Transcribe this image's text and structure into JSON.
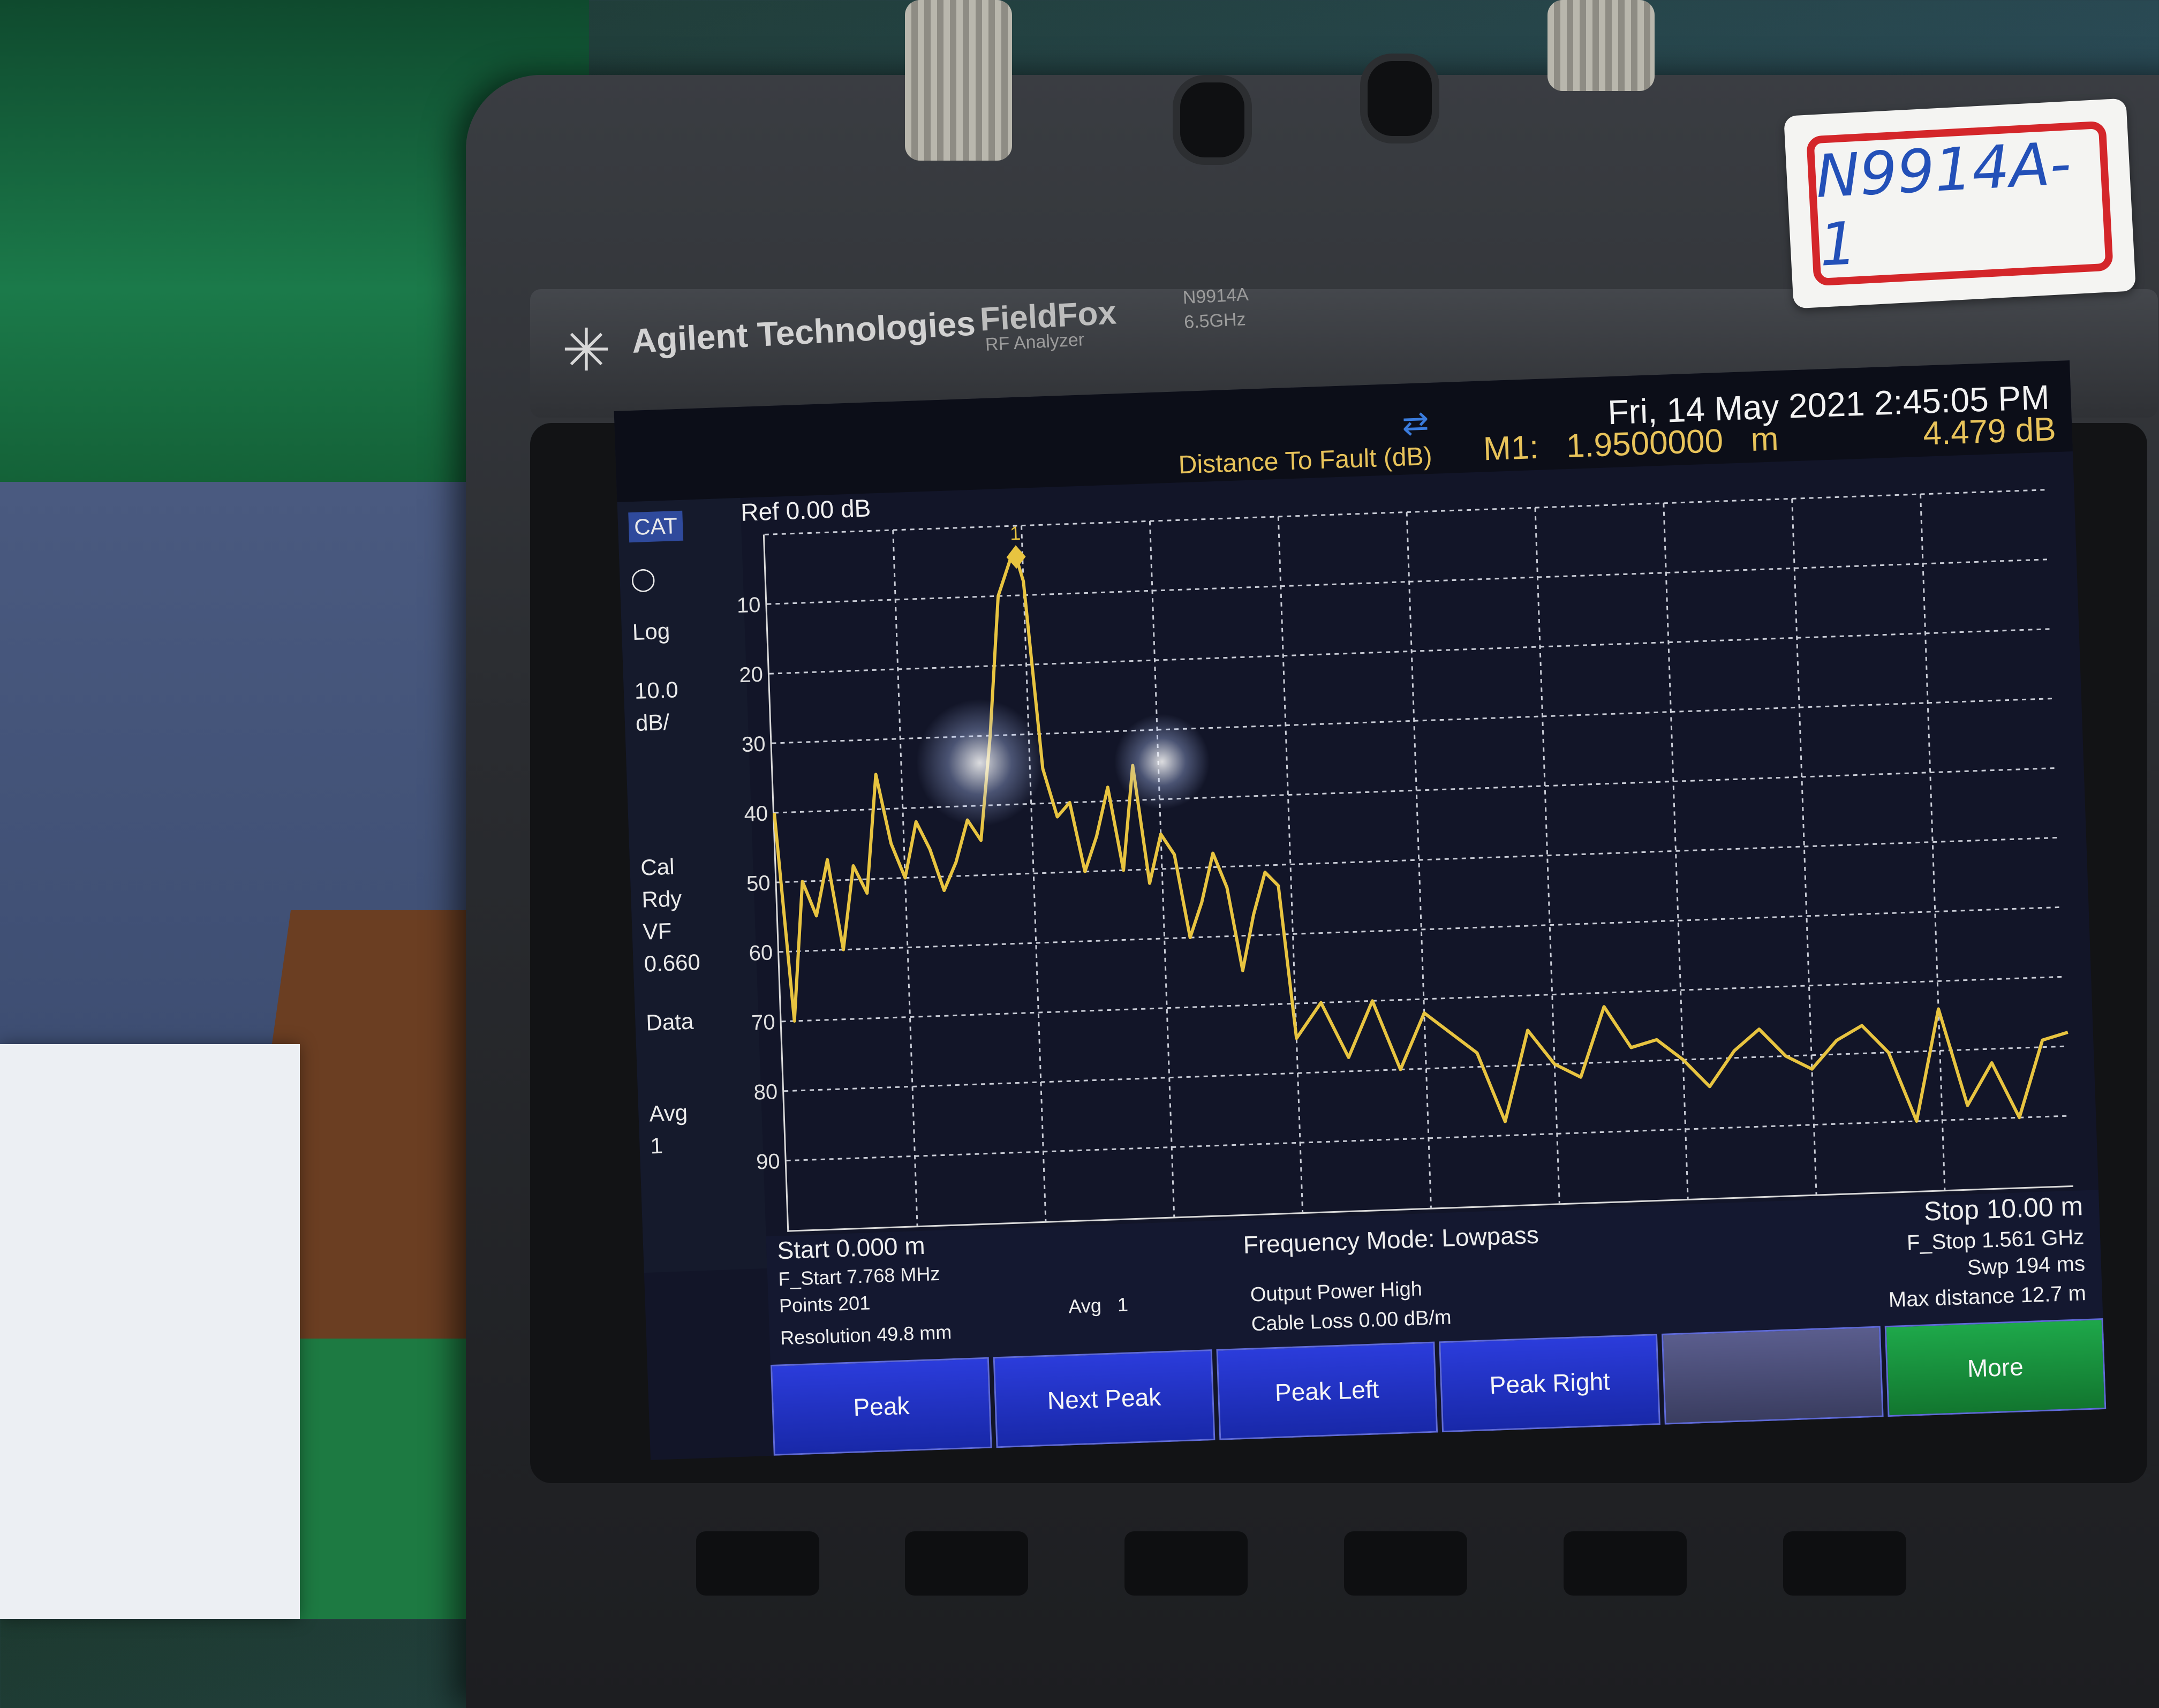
{
  "brand": {
    "company": "Agilent Technologies",
    "product": "FieldFox",
    "product_sub": "RF Analyzer",
    "model": "N9914A",
    "freq": "6.5GHz"
  },
  "asset_label": "N9914A-1",
  "status": {
    "datetime": "Fri, 14 May 2021 2:45:05 PM",
    "mode_title": "Distance To Fault (dB)",
    "marker_name": "M1:",
    "marker_distance": "1.9500000",
    "marker_unit": "m",
    "marker_value": "4.479 dB"
  },
  "left_panel": {
    "cat": "CAT",
    "ref": "Ref 0.00 dB",
    "scale_type": "Log",
    "scale_value": "10.0",
    "scale_unit": "dB/",
    "cal": "Cal",
    "rdy": "Rdy",
    "vf_label": "VF",
    "vf_value": "0.660",
    "data": "Data",
    "avg_label": "Avg",
    "avg_value": "1"
  },
  "info": {
    "start": "Start 0.000 m",
    "f_start": "F_Start 7.768 MHz",
    "points": "Points 201",
    "resolution": "Resolution 49.8 mm",
    "avg": "Avg",
    "avg_value": "1",
    "freq_mode": "Frequency Mode: Lowpass",
    "output_power": "Output Power High",
    "cable_loss": "Cable Loss 0.00  dB/m",
    "stop": "Stop 10.00 m",
    "f_stop": "F_Stop 1.561 GHz",
    "swp": "Swp 194 ms",
    "max_distance": "Max distance 12.7  m"
  },
  "softkeys": [
    "Peak",
    "Next Peak",
    "Peak Left",
    "Peak Right",
    "",
    "More"
  ],
  "chart_data": {
    "type": "line",
    "title": "Distance To Fault (dB)",
    "xlabel": "",
    "ylabel": "",
    "xlim": [
      0,
      10
    ],
    "ylim": [
      -100,
      0
    ],
    "y_ticks": [
      "10",
      "20",
      "30",
      "40",
      "50",
      "60",
      "70",
      "80",
      "90"
    ],
    "grid": true,
    "trace_color": "#e8c440",
    "marker": {
      "label": "1",
      "x": 1.95,
      "y": -4.479
    },
    "series": [
      {
        "x": [
          0,
          0.1,
          0.2,
          0.3,
          0.4,
          0.5,
          0.6,
          0.7,
          0.8,
          0.9,
          1.0,
          1.1,
          1.2,
          1.3,
          1.4,
          1.5,
          1.6,
          1.7,
          1.8,
          1.9,
          1.95,
          2.0,
          2.1,
          2.2,
          2.3,
          2.4,
          2.5,
          2.6,
          2.7,
          2.8,
          2.9,
          3.0,
          3.1,
          3.2,
          3.3,
          3.4,
          3.5,
          3.6,
          3.7,
          3.8,
          3.9,
          4.0,
          4.2,
          4.4,
          4.6,
          4.8,
          5.0,
          5.2,
          5.4,
          5.6,
          5.8,
          6.0,
          6.2,
          6.4,
          6.6,
          6.8,
          7.0,
          7.2,
          7.4,
          7.6,
          7.8,
          8.0,
          8.2,
          8.4,
          8.6,
          8.8,
          9.0,
          9.2,
          9.4,
          9.6,
          9.8,
          10.0
        ],
        "y": [
          -40,
          -70,
          -50,
          -55,
          -47,
          -60,
          -48,
          -52,
          -35,
          -45,
          -50,
          -42,
          -46,
          -52,
          -48,
          -42,
          -45,
          -30,
          -10,
          -5,
          -4.5,
          -8,
          -35,
          -42,
          -40,
          -50,
          -45,
          -38,
          -50,
          -35,
          -52,
          -45,
          -48,
          -60,
          -55,
          -48,
          -53,
          -65,
          -57,
          -51,
          -53,
          -75,
          -70,
          -78,
          -70,
          -80,
          -72,
          -75,
          -78,
          -88,
          -75,
          -80,
          -82,
          -72,
          -78,
          -77,
          -80,
          -84,
          -79,
          -76,
          -80,
          -82,
          -78,
          -76,
          -80,
          -90,
          -74,
          -88,
          -82,
          -90,
          -79,
          -78
        ]
      }
    ]
  }
}
